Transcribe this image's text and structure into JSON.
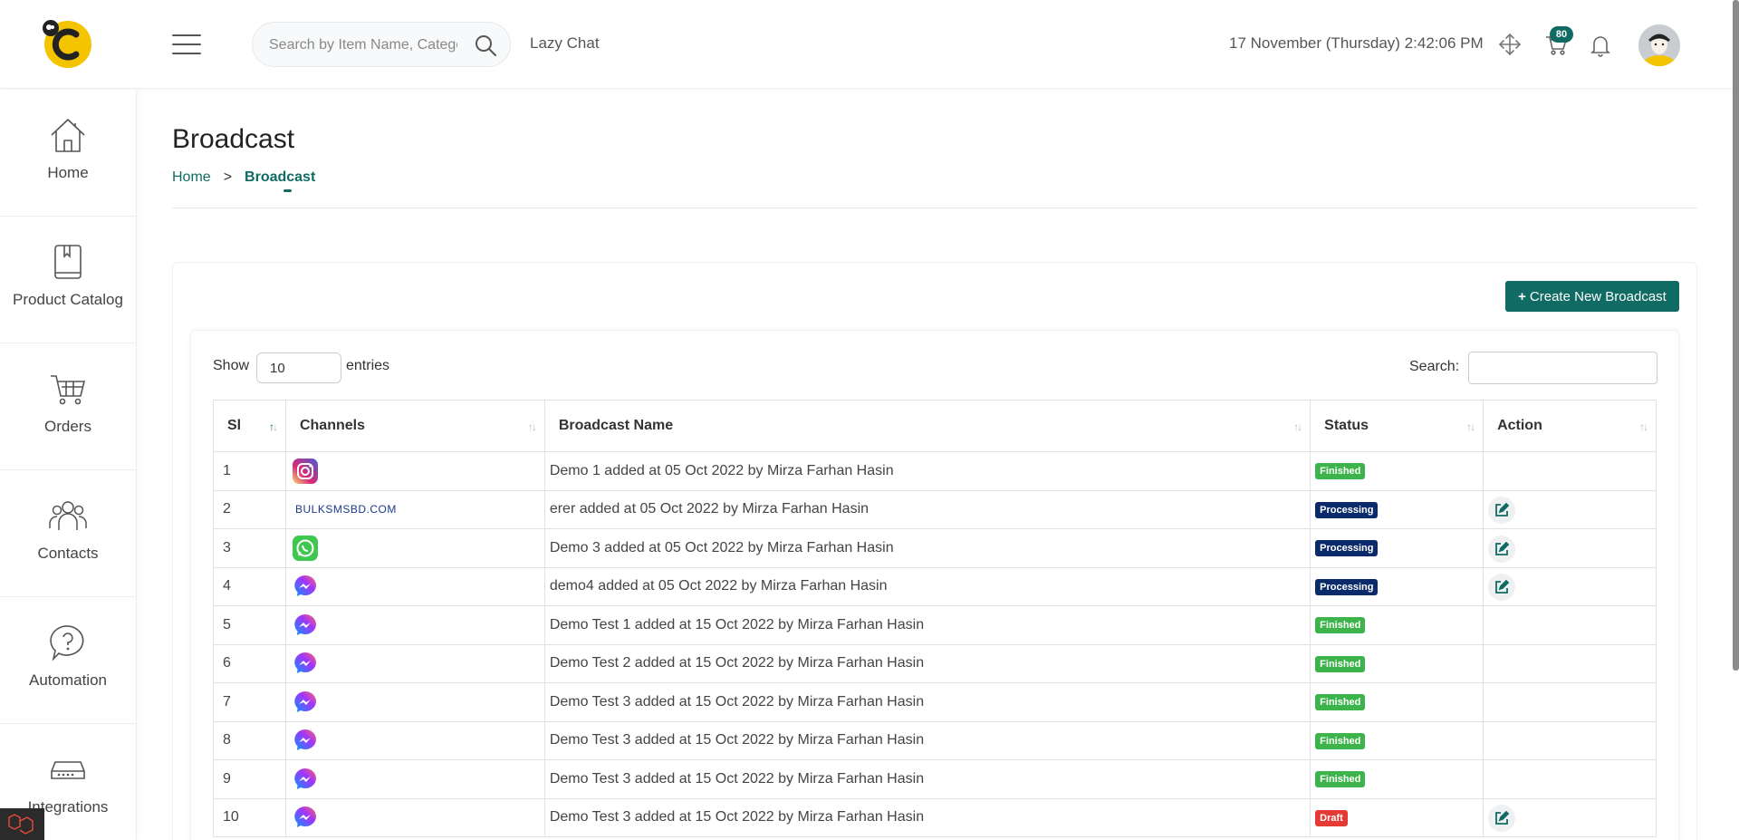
{
  "header": {
    "search_placeholder": "Search by Item Name, Category",
    "app_link": "Lazy Chat",
    "datetime": "17 November (Thursday) 2:42:06 PM",
    "cart_count": "80"
  },
  "sidebar": {
    "items": [
      {
        "label": "Home",
        "icon": "home-icon"
      },
      {
        "label": "Product Catalog",
        "icon": "book-icon"
      },
      {
        "label": "Orders",
        "icon": "cart-icon"
      },
      {
        "label": "Contacts",
        "icon": "users-icon"
      },
      {
        "label": "Automation",
        "icon": "question-bubble-icon"
      },
      {
        "label": "Integrations",
        "icon": "router-icon"
      }
    ]
  },
  "page": {
    "title": "Broadcast",
    "breadcrumb_home": "Home",
    "breadcrumb_sep": ">",
    "breadcrumb_current": "Broadcast",
    "create_button": "Create New Broadcast"
  },
  "table_controls": {
    "show_label": "Show",
    "entries_value": "10",
    "entries_label": "entries",
    "search_label": "Search:"
  },
  "table": {
    "headers": [
      "Sl",
      "Channels",
      "Broadcast Name",
      "Status",
      "Action"
    ],
    "rows": [
      {
        "sl": "1",
        "channel": "instagram",
        "name": "Demo 1 added at 05 Oct 2022 by Mirza Farhan Hasin",
        "status": "Finished",
        "editable": false
      },
      {
        "sl": "2",
        "channel": "bulksms",
        "channel_text": "BULKSMSBD.COM",
        "name": "erer added at 05 Oct 2022 by Mirza Farhan Hasin",
        "status": "Processing",
        "editable": true
      },
      {
        "sl": "3",
        "channel": "whatsapp",
        "name": "Demo 3 added at 05 Oct 2022 by Mirza Farhan Hasin",
        "status": "Processing",
        "editable": true
      },
      {
        "sl": "4",
        "channel": "messenger",
        "name": "demo4 added at 05 Oct 2022 by Mirza Farhan Hasin",
        "status": "Processing",
        "editable": true
      },
      {
        "sl": "5",
        "channel": "messenger",
        "name": "Demo Test 1 added at 15 Oct 2022 by Mirza Farhan Hasin",
        "status": "Finished",
        "editable": false
      },
      {
        "sl": "6",
        "channel": "messenger",
        "name": "Demo Test 2 added at 15 Oct 2022 by Mirza Farhan Hasin",
        "status": "Finished",
        "editable": false
      },
      {
        "sl": "7",
        "channel": "messenger",
        "name": "Demo Test 3 added at 15 Oct 2022 by Mirza Farhan Hasin",
        "status": "Finished",
        "editable": false
      },
      {
        "sl": "8",
        "channel": "messenger",
        "name": "Demo Test 3 added at 15 Oct 2022 by Mirza Farhan Hasin",
        "status": "Finished",
        "editable": false
      },
      {
        "sl": "9",
        "channel": "messenger",
        "name": "Demo Test 3 added at 15 Oct 2022 by Mirza Farhan Hasin",
        "status": "Finished",
        "editable": false
      },
      {
        "sl": "10",
        "channel": "messenger",
        "name": "Demo Test 3 added at 15 Oct 2022 by Mirza Farhan Hasin",
        "status": "Draft",
        "editable": true
      }
    ]
  },
  "colors": {
    "accent": "#0f6b63",
    "finished": "#3cb44b",
    "processing": "#0b2a6b",
    "draft": "#e53935"
  }
}
